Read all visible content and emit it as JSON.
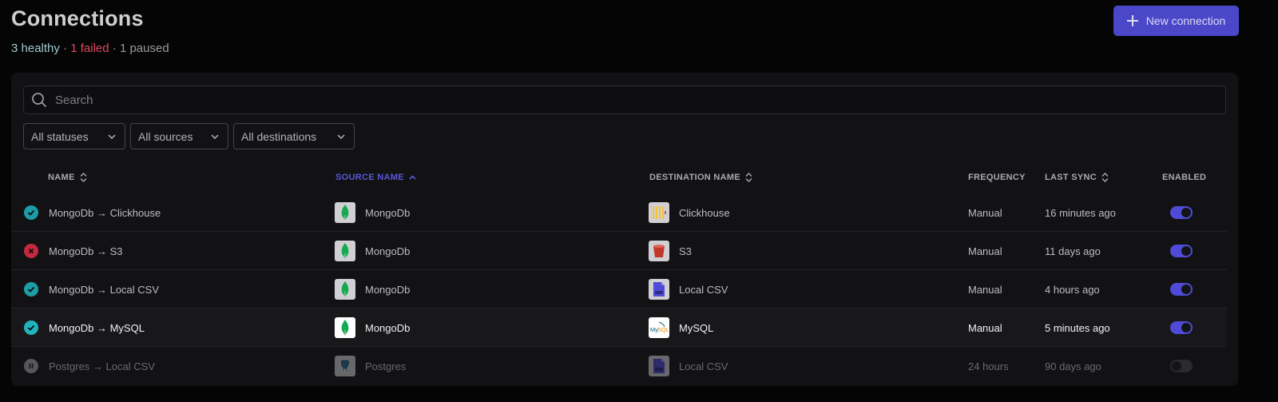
{
  "header": {
    "title": "Connections",
    "summary": {
      "healthy": "3 healthy",
      "sep1": " · ",
      "failed": "1 failed",
      "sep2": " · ",
      "paused": "1 paused"
    },
    "new_button": "New connection"
  },
  "search": {
    "placeholder": "Search"
  },
  "filters": [
    "All statuses",
    "All sources",
    "All destinations"
  ],
  "columns": {
    "name": "NAME",
    "source": "SOURCE NAME",
    "destination": "DESTINATION NAME",
    "frequency": "FREQUENCY",
    "last_sync": "LAST SYNC",
    "enabled": "ENABLED"
  },
  "rows": [
    {
      "status": "healthy",
      "name": "MongoDb → Clickhouse",
      "source": "MongoDb",
      "source_icon": "mongodb-icon",
      "destination": "Clickhouse",
      "destination_icon": "clickhouse-icon",
      "frequency": "Manual",
      "last_sync": "16 minutes ago",
      "enabled": true
    },
    {
      "status": "failed",
      "name": "MongoDb → S3",
      "source": "MongoDb",
      "source_icon": "mongodb-icon",
      "destination": "S3",
      "destination_icon": "s3-bucket-icon",
      "frequency": "Manual",
      "last_sync": "11 days ago",
      "enabled": true
    },
    {
      "status": "healthy",
      "name": "MongoDb → Local CSV",
      "source": "MongoDb",
      "source_icon": "mongodb-icon",
      "destination": "Local CSV",
      "destination_icon": "csv-file-icon",
      "frequency": "Manual",
      "last_sync": "4 hours ago",
      "enabled": true
    },
    {
      "status": "healthy",
      "name": "MongoDb → MySQL",
      "source": "MongoDb",
      "source_icon": "mongodb-icon",
      "destination": "MySQL",
      "destination_icon": "mysql-icon",
      "frequency": "Manual",
      "last_sync": "5 minutes ago",
      "enabled": true
    },
    {
      "status": "paused",
      "name": "Postgres → Local CSV",
      "source": "Postgres",
      "source_icon": "postgres-elephant-icon",
      "destination": "Local CSV",
      "destination_icon": "csv-file-icon",
      "frequency": "24 hours",
      "last_sync": "90 days ago",
      "enabled": false
    }
  ],
  "colors": {
    "accent": "#4a47c9",
    "healthy": "#1d9ca5",
    "failed": "#c6283f",
    "paused": "#56565c",
    "failed_text": "#e0485c"
  }
}
